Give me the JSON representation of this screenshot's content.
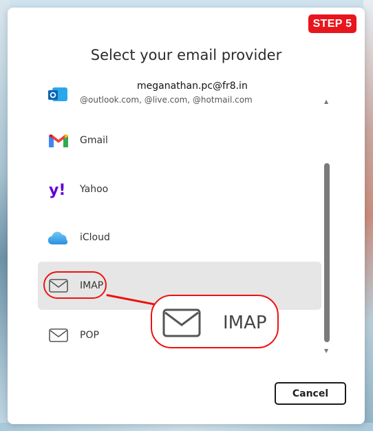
{
  "step_badge": "STEP 5",
  "title": "Select your email provider",
  "providers": [
    {
      "label": "meganathan.pc@fr8.in",
      "sub": "@outlook.com, @live.com, @hotmail.com",
      "icon": "outlook-icon"
    },
    {
      "label": "Gmail",
      "icon": "gmail-icon"
    },
    {
      "label": "Yahoo",
      "icon": "yahoo-icon"
    },
    {
      "label": "iCloud",
      "icon": "icloud-icon"
    },
    {
      "label": "IMAP",
      "icon": "mail-icon",
      "selected": true
    },
    {
      "label": "POP",
      "icon": "mail-icon"
    }
  ],
  "callout": {
    "label": "IMAP"
  },
  "buttons": {
    "cancel": "Cancel"
  },
  "colors": {
    "step_badge": "#e8161c",
    "annotation": "#ee1111",
    "selected_row": "#e6e6e6"
  }
}
